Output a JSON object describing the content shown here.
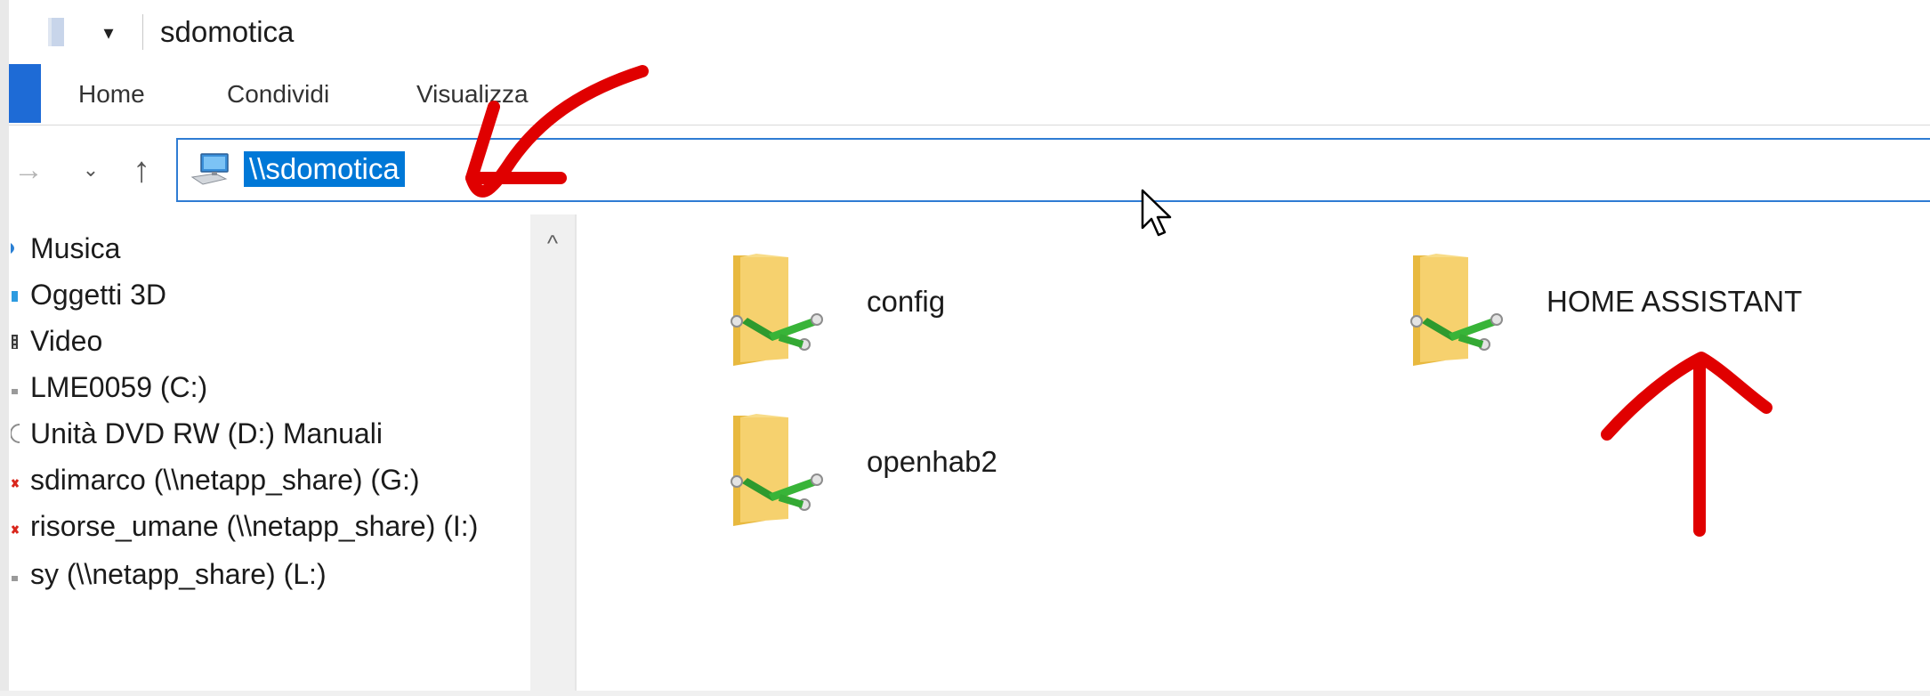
{
  "window": {
    "title": "sdomotica"
  },
  "ribbon": {
    "tabs": [
      {
        "label": "Home"
      },
      {
        "label": "Condividi"
      },
      {
        "label": "Visualizza"
      }
    ]
  },
  "address_bar": {
    "value": "\\\\sdomotica"
  },
  "navigation_pane": {
    "items": [
      {
        "label": "Musica",
        "icon": "music-icon"
      },
      {
        "label": "Oggetti 3D",
        "icon": "objects-3d-icon"
      },
      {
        "label": "Video",
        "icon": "video-icon"
      },
      {
        "label": "LME0059 (C:)",
        "icon": "drive-icon"
      },
      {
        "label": "Unità DVD RW (D:) Manuali",
        "icon": "dvd-icon"
      },
      {
        "label": "sdimarco (\\\\netapp_share) (G:)",
        "icon": "network-drive-disconnected-icon"
      },
      {
        "label": "risorse_umane (\\\\netapp_share) (I:)",
        "icon": "network-drive-disconnected-icon"
      },
      {
        "label": "sy (\\\\netapp_share) (L:)",
        "icon": "network-drive-icon"
      }
    ]
  },
  "content": {
    "items": [
      {
        "name": "config",
        "icon": "shared-folder-icon"
      },
      {
        "name": "HOME ASSISTANT",
        "icon": "shared-folder-icon"
      },
      {
        "name": "openhab2",
        "icon": "shared-folder-icon"
      }
    ]
  },
  "colors": {
    "accent": "#0078d7",
    "file_tab": "#1e6bd6",
    "annotation": "#e00000"
  }
}
